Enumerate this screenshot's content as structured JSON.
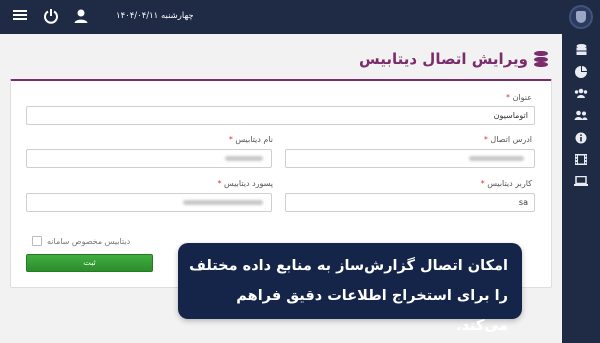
{
  "header": {
    "date": "چهارشنبه ۱۴۰۴/۰۴/۱۱",
    "menu_icon": "hamburger-icon",
    "power_icon": "power-icon",
    "user_icon": "user-icon"
  },
  "sidebar": {
    "items": [
      {
        "icon": "database-icon"
      },
      {
        "icon": "pie-chart-icon"
      },
      {
        "icon": "users-icon"
      },
      {
        "icon": "user-group-icon"
      },
      {
        "icon": "info-icon"
      },
      {
        "icon": "film-icon"
      },
      {
        "icon": "laptop-icon"
      }
    ]
  },
  "page": {
    "title": "ویرایش اتصال دیتابیس"
  },
  "form": {
    "title_label": "عنوان",
    "title_value": "اتوماسیون",
    "connection_address_label": "ادرس اتصال",
    "database_name_label": "نام دیتابیس",
    "database_user_label": "کاربر دیتابیس",
    "database_user_value": "sa",
    "database_password_label": "پسورد دیتابیس",
    "required_mark": "*",
    "system_db_checkbox_label": "دیتابیس مخصوص سامانه",
    "submit_label": "ثبت"
  },
  "callout": {
    "text": "امکان اتصال گزارش‌ساز به منابع داده مختلف را برای استخراج اطلاعات دقیق فراهم می‌کند."
  },
  "colors": {
    "navy": "#1f2a44",
    "accent": "#7b2c6a",
    "success": "#2c8d2c"
  }
}
